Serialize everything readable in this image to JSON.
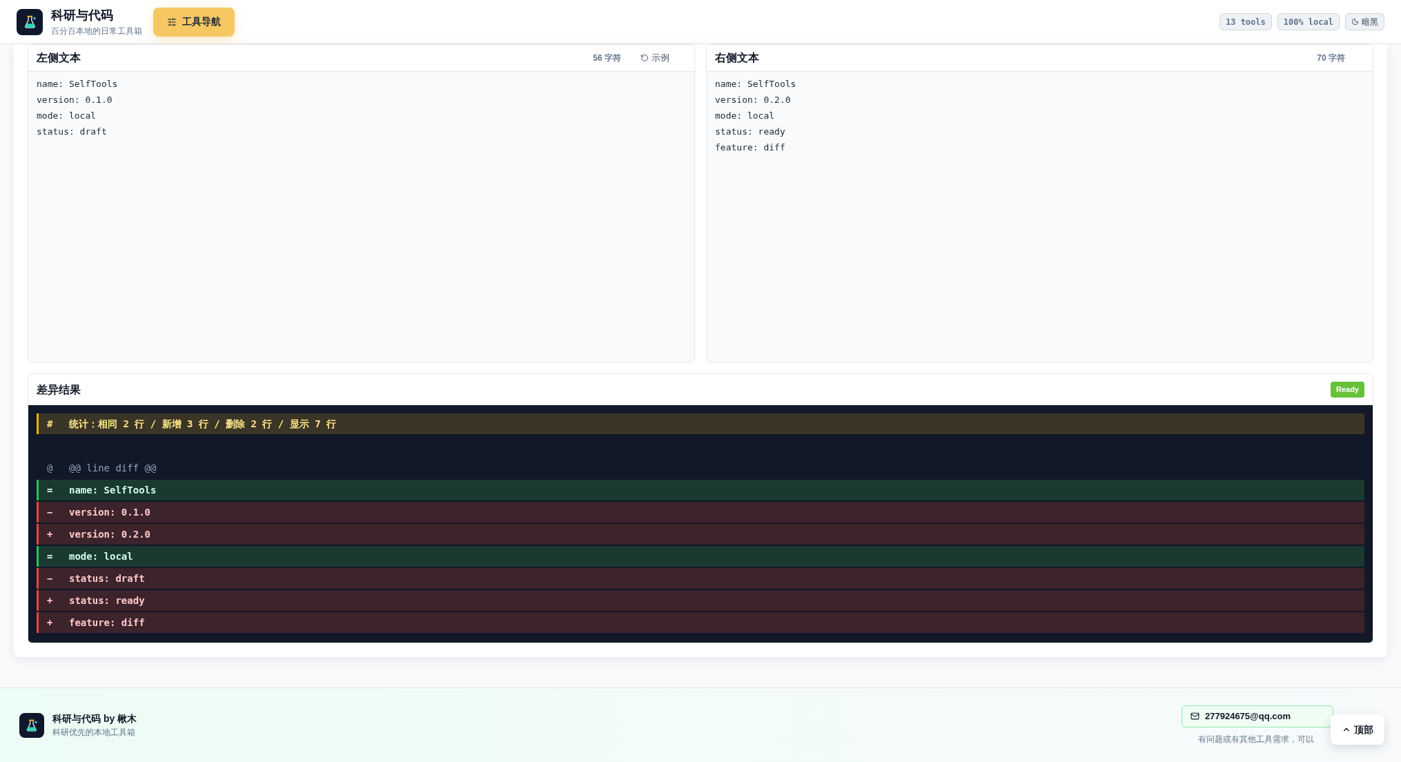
{
  "header": {
    "app_name": "科研与代码",
    "tagline": "百分百本地的日常工具箱",
    "nav_button": "工具导航",
    "badges": [
      "13 tools",
      "100% local"
    ],
    "theme_button": "暗黑"
  },
  "left_panel": {
    "title": "左侧文本",
    "count": "56 字符",
    "example_button": "示例",
    "lines": [
      "name: SelfTools",
      "version: 0.1.0",
      "mode: local",
      "status: draft"
    ]
  },
  "right_panel": {
    "title": "右侧文本",
    "count": "70 字符",
    "lines": [
      "name: SelfTools",
      "version: 0.2.0",
      "mode: local",
      "status: ready",
      "feature: diff"
    ]
  },
  "result": {
    "title": "差异结果",
    "status": "Ready",
    "rows": [
      {
        "kind": "stat",
        "sign": "#",
        "text": "统计：相同 2 行 / 新增 3 行 / 删除 2 行 / 显示 7 行"
      },
      {
        "kind": "hunk",
        "sign": "@",
        "text": "@@ line diff @@"
      },
      {
        "kind": "same",
        "sign": "=",
        "text": "name: SelfTools"
      },
      {
        "kind": "change",
        "sign": "−",
        "text": "version: 0.1.0"
      },
      {
        "kind": "change",
        "sign": "+",
        "text": "version: 0.2.0"
      },
      {
        "kind": "same",
        "sign": "=",
        "text": "mode: local"
      },
      {
        "kind": "change",
        "sign": "−",
        "text": "status: draft"
      },
      {
        "kind": "change",
        "sign": "+",
        "text": "status: ready"
      },
      {
        "kind": "change",
        "sign": "+",
        "text": "feature: diff"
      }
    ]
  },
  "footer": {
    "name": "科研与代码 by 楸木",
    "tagline": "科研优先的本地工具箱",
    "email": "277924675@qq.com",
    "note": "有问题或有其他工具需求，可以",
    "top_button": "顶部"
  }
}
